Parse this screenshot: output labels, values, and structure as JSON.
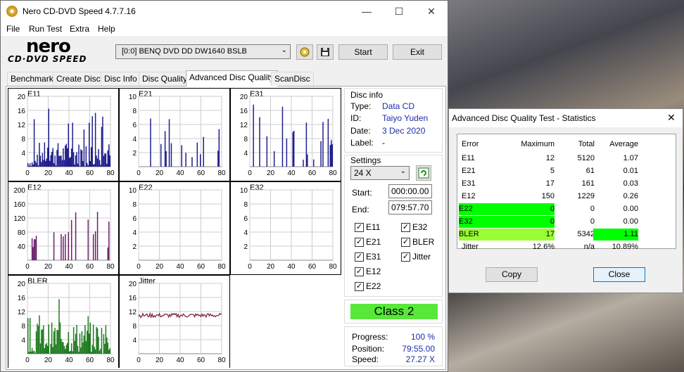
{
  "window": {
    "title": "Nero CD-DVD Speed 4.7.7.16",
    "minimize": "—",
    "maximize": "☐",
    "close": "✕"
  },
  "menu": [
    "File",
    "Run Test",
    "Extra",
    "Help"
  ],
  "logo": {
    "brand": "nero",
    "product": "CD·DVD SPEED"
  },
  "toolbar": {
    "drive": "[0:0]   BENQ DVD DD DW1640 BSLB",
    "start": "Start",
    "exit": "Exit"
  },
  "tabs": [
    "Benchmark",
    "Create Disc",
    "Disc Info",
    "Disc Quality",
    "Advanced Disc Quality",
    "ScanDisc"
  ],
  "active_tab": "Advanced Disc Quality",
  "disc_info": {
    "header": "Disc info",
    "type_label": "Type:",
    "type": "Data CD",
    "id_label": "ID:",
    "id": "Taiyo Yuden",
    "date_label": "Date:",
    "date": "3 Dec 2020",
    "label_label": "Label:",
    "label": "-"
  },
  "settings": {
    "header": "Settings",
    "speed": "24 X",
    "start_label": "Start:",
    "start": "000:00.00",
    "end_label": "End:",
    "end": "079:57.70"
  },
  "checks": {
    "e11": "E11",
    "e21": "E21",
    "e31": "E31",
    "e12": "E12",
    "e22": "E22",
    "e32": "E32",
    "bler": "BLER",
    "jitter": "Jitter"
  },
  "class_label": "Class 2",
  "progress": {
    "progress_label": "Progress:",
    "progress": "100 %",
    "position_label": "Position:",
    "position": "79:55.00",
    "speed_label": "Speed:",
    "speed": "27.27 X"
  },
  "chart_data": [
    {
      "type": "bar",
      "title": "E11",
      "xlim": [
        0,
        80
      ],
      "ylim": [
        0,
        20
      ],
      "yticks": [
        4,
        8,
        12,
        16,
        20
      ],
      "xticks": [
        0,
        20,
        40,
        60,
        80
      ],
      "color": "#1c1c8c"
    },
    {
      "type": "bar",
      "title": "E21",
      "xlim": [
        0,
        80
      ],
      "ylim": [
        0,
        10
      ],
      "yticks": [
        2,
        4,
        6,
        8,
        10
      ],
      "xticks": [
        0,
        20,
        40,
        60,
        80
      ],
      "color": "#1c1c8c"
    },
    {
      "type": "bar",
      "title": "E31",
      "xlim": [
        0,
        80
      ],
      "ylim": [
        0,
        20
      ],
      "yticks": [
        4,
        8,
        12,
        16,
        20
      ],
      "xticks": [
        0,
        20,
        40,
        60,
        80
      ],
      "color": "#1c1c8c"
    },
    {
      "type": "bar",
      "title": "E12",
      "xlim": [
        0,
        80
      ],
      "ylim": [
        0,
        200
      ],
      "yticks": [
        40,
        80,
        120,
        160,
        200
      ],
      "xticks": [
        0,
        20,
        40,
        60,
        80
      ],
      "color": "#6a1c6a"
    },
    {
      "type": "bar",
      "title": "E22",
      "xlim": [
        0,
        80
      ],
      "ylim": [
        0,
        10
      ],
      "yticks": [
        2,
        4,
        6,
        8,
        10
      ],
      "xticks": [
        0,
        20,
        40,
        60,
        80
      ],
      "color": "#6a1c6a"
    },
    {
      "type": "bar",
      "title": "E32",
      "xlim": [
        0,
        80
      ],
      "ylim": [
        0,
        10
      ],
      "yticks": [
        2,
        4,
        6,
        8,
        10
      ],
      "xticks": [
        0,
        20,
        40,
        60,
        80
      ],
      "color": "#6a1c6a"
    },
    {
      "type": "bar",
      "title": "BLER",
      "xlim": [
        0,
        80
      ],
      "ylim": [
        0,
        20
      ],
      "yticks": [
        4,
        8,
        12,
        16,
        20
      ],
      "xticks": [
        0,
        20,
        40,
        60,
        80
      ],
      "color": "#1c7a1c"
    },
    {
      "type": "line",
      "title": "Jitter",
      "xlim": [
        0,
        80
      ],
      "ylim": [
        0,
        20
      ],
      "yticks": [
        4,
        8,
        12,
        16,
        20
      ],
      "xticks": [
        0,
        20,
        40,
        60,
        80
      ],
      "color": "#7a1c3c",
      "level": 10.9
    }
  ],
  "stats": {
    "title": "Advanced Disc Quality Test - Statistics",
    "headers": [
      "Error",
      "Maximum",
      "Total",
      "Average"
    ],
    "rows": [
      [
        "E11",
        "12",
        "5120",
        "1.07"
      ],
      [
        "E21",
        "5",
        "61",
        "0.01"
      ],
      [
        "E31",
        "17",
        "161",
        "0.03"
      ],
      [
        "E12",
        "150",
        "1229",
        "0.26"
      ],
      [
        "E22",
        "0",
        "0",
        "0.00"
      ],
      [
        "E32",
        "0",
        "0",
        "0.00"
      ],
      [
        "BLER",
        "17",
        "5342",
        "1.11"
      ],
      [
        "Jitter",
        "12.6%",
        "n/a",
        "10.89%"
      ]
    ],
    "copy": "Copy",
    "close": "Close",
    "colors": {
      "green": "#00ff00",
      "lime": "#99ff33",
      "class_bg": "#57e83a"
    }
  }
}
